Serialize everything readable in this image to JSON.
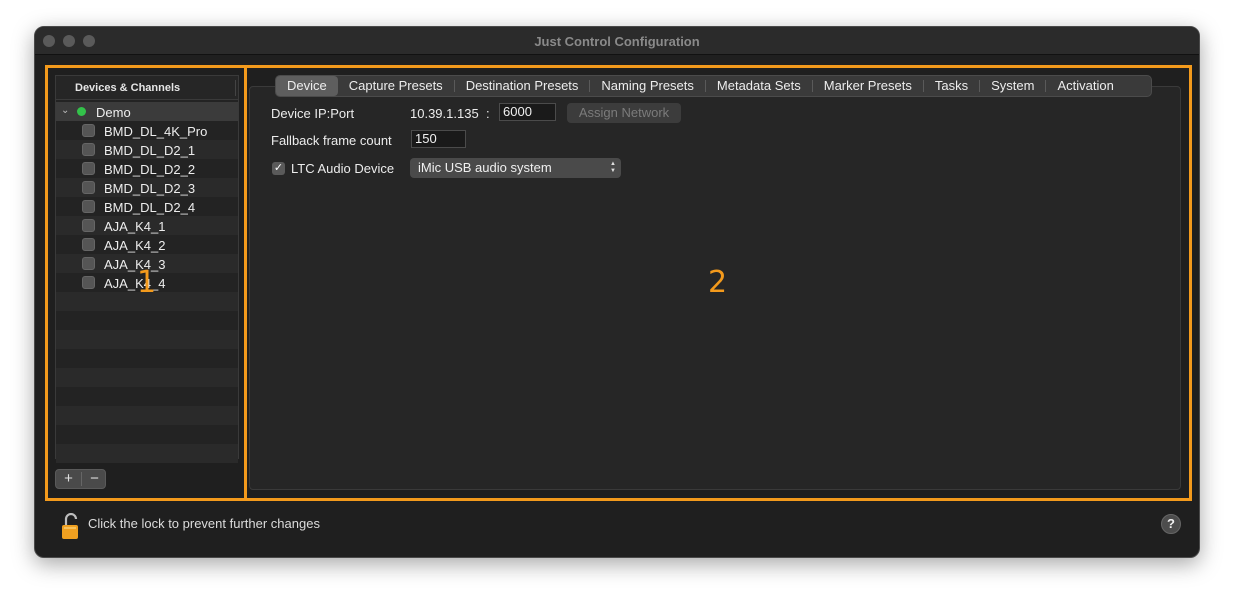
{
  "window": {
    "title": "Just Control Configuration"
  },
  "annotations": {
    "label1": "1",
    "label2": "2",
    "color": "#f39a1c"
  },
  "sidebar": {
    "header": "Devices & Channels",
    "root": {
      "label": "Demo",
      "status_color": "#33c24a",
      "expanded": true
    },
    "items": [
      {
        "label": "BMD_DL_4K_Pro"
      },
      {
        "label": "BMD_DL_D2_1"
      },
      {
        "label": "BMD_DL_D2_2"
      },
      {
        "label": "BMD_DL_D2_3"
      },
      {
        "label": "BMD_DL_D2_4"
      },
      {
        "label": "AJA_K4_1"
      },
      {
        "label": "AJA_K4_2"
      },
      {
        "label": "AJA_K4_3"
      },
      {
        "label": "AJA_K4_4"
      }
    ],
    "add_label": "+",
    "remove_label": "−"
  },
  "tabs": [
    {
      "label": "Device",
      "active": true
    },
    {
      "label": "Capture Presets"
    },
    {
      "label": "Destination Presets"
    },
    {
      "label": "Naming Presets"
    },
    {
      "label": "Metadata Sets"
    },
    {
      "label": "Marker Presets"
    },
    {
      "label": "Tasks"
    },
    {
      "label": "System"
    },
    {
      "label": "Activation"
    }
  ],
  "device": {
    "ip_port_label": "Device IP:Port",
    "ip": "10.39.1.135",
    "ip_sep": ":",
    "port": "6000",
    "assign_network_label": "Assign Network",
    "fallback_label": "Fallback frame count",
    "fallback_value": "150",
    "ltc_label": "LTC Audio Device",
    "ltc_checked": true,
    "ltc_device": "iMic USB audio system"
  },
  "footer": {
    "lock_text": "Click the lock to prevent further changes",
    "help_label": "?"
  }
}
